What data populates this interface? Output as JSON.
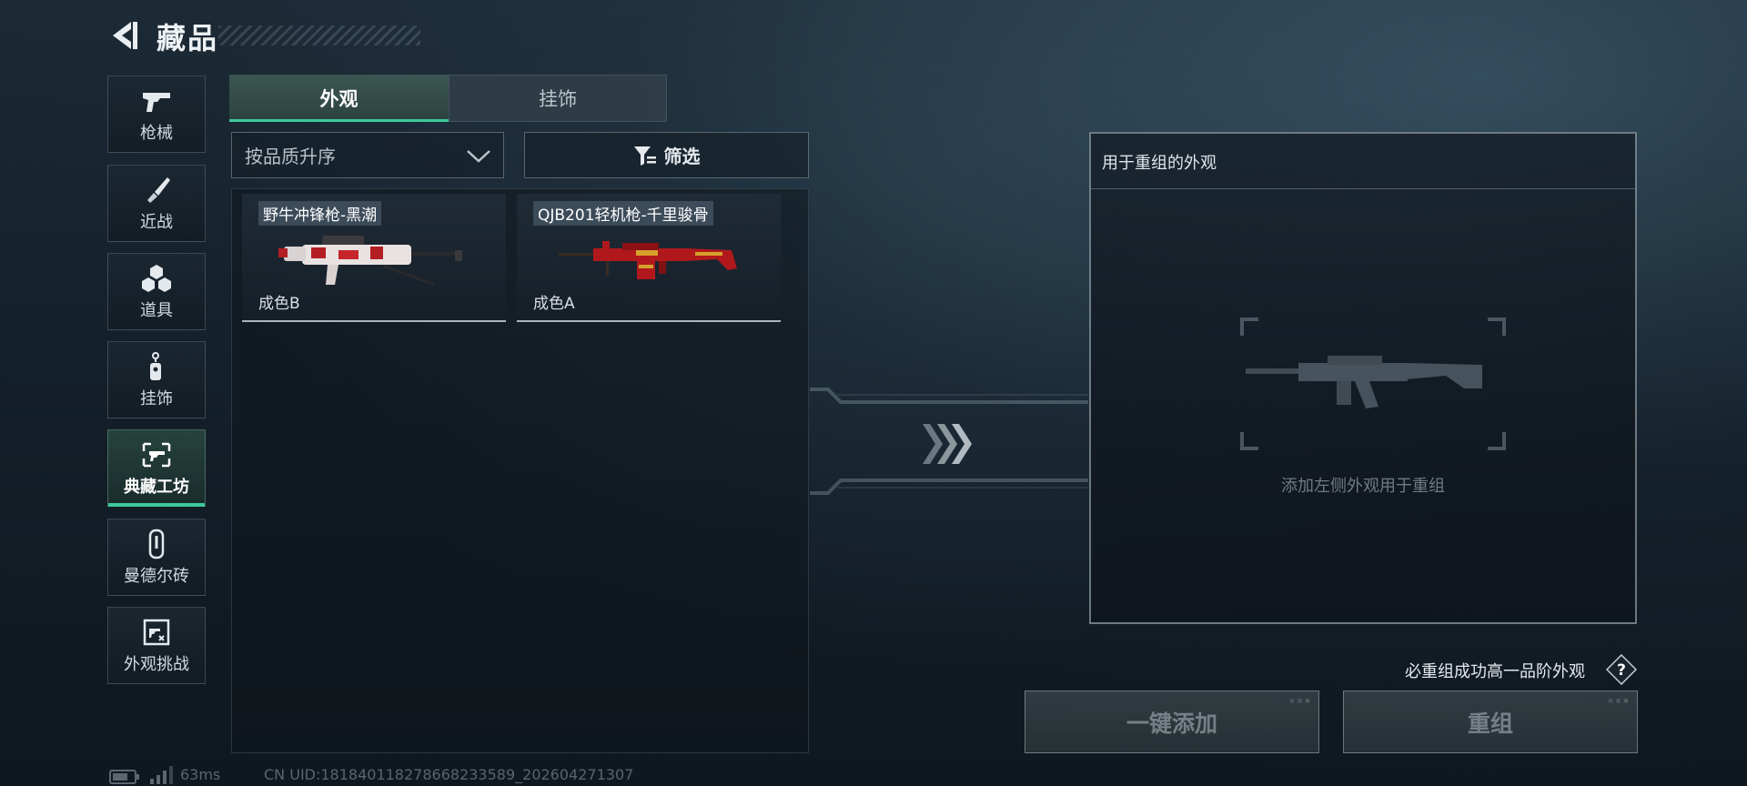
{
  "header": {
    "title": "藏品"
  },
  "sidebar": {
    "items": [
      {
        "label": "枪械",
        "icon": "pistol-icon",
        "active": false
      },
      {
        "label": "近战",
        "icon": "knife-icon",
        "active": false
      },
      {
        "label": "道具",
        "icon": "cubes-icon",
        "active": false
      },
      {
        "label": "挂饰",
        "icon": "charm-icon",
        "active": false
      },
      {
        "label": "典藏工坊",
        "icon": "workshop-icon",
        "active": true
      },
      {
        "label": "曼德尔砖",
        "icon": "brick-icon",
        "active": false
      },
      {
        "label": "外观挑战",
        "icon": "challenge-icon",
        "active": false
      }
    ]
  },
  "tabs": [
    {
      "label": "外观",
      "active": true
    },
    {
      "label": "挂饰",
      "active": false
    }
  ],
  "sort": {
    "selected": "按品质升序"
  },
  "filter": {
    "label": "筛选"
  },
  "items": [
    {
      "name": "野牛冲锋枪-黑潮",
      "quality": "成色B"
    },
    {
      "name": "QJB201轻机枪-千里骏骨",
      "quality": "成色A"
    }
  ],
  "recombine": {
    "title": "用于重组的外观",
    "hint": "添加左侧外观用于重组"
  },
  "guarantee_text": "必重组成功高一品阶外观",
  "help_label": "?",
  "buttons": {
    "add": "一键添加",
    "recombine": "重组"
  },
  "status": {
    "ping": "63ms",
    "uid": "CN UID:18184011827866823358​9_202604271307"
  },
  "colors": {
    "accent": "#3ec99a",
    "panel_border": "#b9c8d2"
  }
}
